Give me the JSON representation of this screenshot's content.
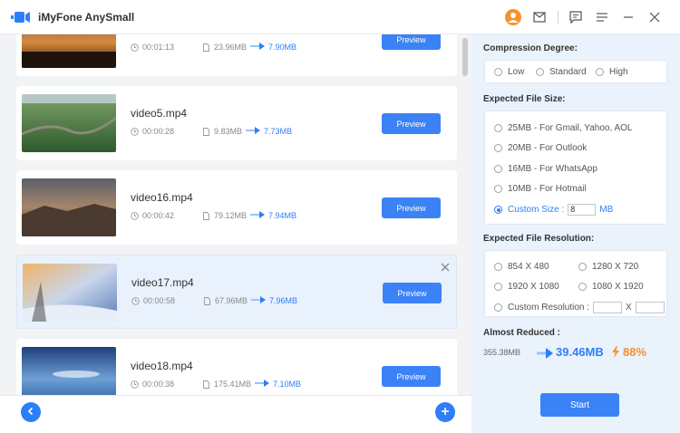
{
  "app": {
    "title": "iMyFone AnySmall"
  },
  "colors": {
    "accent": "#3b82f6",
    "orange": "#f6922d"
  },
  "videos": [
    {
      "name": "",
      "duration": "00:01:13",
      "original_size": "23.96MB",
      "compressed_size": "7.90MB",
      "preview_label": "Preview"
    },
    {
      "name": "video5.mp4",
      "duration": "00:00:28",
      "original_size": "9.83MB",
      "compressed_size": "7.73MB",
      "preview_label": "Preview"
    },
    {
      "name": "video16.mp4",
      "duration": "00:00:42",
      "original_size": "79.12MB",
      "compressed_size": "7.94MB",
      "preview_label": "Preview"
    },
    {
      "name": "video17.mp4",
      "duration": "00:00:58",
      "original_size": "67.96MB",
      "compressed_size": "7.96MB",
      "preview_label": "Preview",
      "selected": true
    },
    {
      "name": "video18.mp4",
      "duration": "00:00:38",
      "original_size": "175.41MB",
      "compressed_size": "7.10MB",
      "preview_label": "Preview"
    }
  ],
  "settings": {
    "compression_title": "Compression Degree:",
    "compression_options": [
      "Low",
      "Standard",
      "High"
    ],
    "filesize_title": "Expected File Size:",
    "filesize_options": [
      "25MB - For Gmail, Yahoo, AOL",
      "20MB - For Outlook",
      "16MB - For WhatsApp",
      "10MB - For Hotmail"
    ],
    "custom_size_label": "Custom Size :",
    "custom_size_value": "8",
    "custom_size_unit": "MB",
    "resolution_title": "Expected File Resolution:",
    "resolution_options": [
      "854 X 480",
      "1280 X 720",
      "1920 X 1080",
      "1080 X 1920"
    ],
    "custom_resolution_label": "Custom Resolution :",
    "custom_resolution_sep": "X",
    "reduced_title": "Almost Reduced :",
    "reduced_original": "355.38MB",
    "reduced_new": "39.46MB",
    "reduced_percent": "88%",
    "start_label": "Start"
  }
}
